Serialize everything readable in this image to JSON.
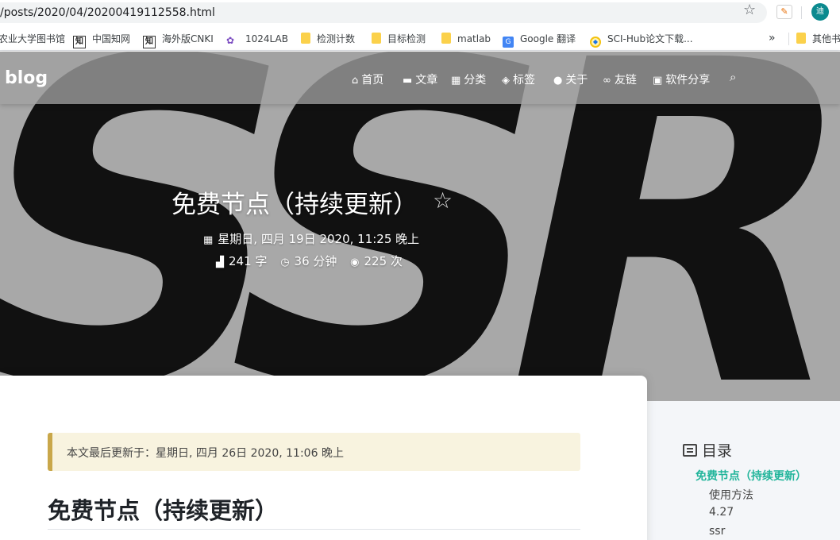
{
  "browser": {
    "url": "/posts/2020/04/20200419112558.html",
    "profile_initial": "迪",
    "bookmarks": [
      {
        "label": "农业大学图书馆",
        "icon": "none"
      },
      {
        "label": "中国知网",
        "icon": "zhi-icon"
      },
      {
        "label": "海外版CNKI",
        "icon": "zhi-icon"
      },
      {
        "label": "1024LAB",
        "icon": "lab-icon"
      },
      {
        "label": "检测计数",
        "icon": "folder-icon"
      },
      {
        "label": "目标检测",
        "icon": "folder-icon"
      },
      {
        "label": "matlab",
        "icon": "folder-icon"
      },
      {
        "label": "Google 翻译",
        "icon": "google-translate-icon"
      },
      {
        "label": "SCI-Hub论文下载...",
        "icon": "scihub-icon"
      },
      {
        "label": "其他书",
        "icon": "folder-icon"
      }
    ],
    "more_label": "»"
  },
  "site": {
    "brand": "blog",
    "nav": [
      {
        "label": "首页",
        "icon": "home-icon"
      },
      {
        "label": "文章",
        "icon": "archive-icon"
      },
      {
        "label": "分类",
        "icon": "category-icon"
      },
      {
        "label": "标签",
        "icon": "tags-icon"
      },
      {
        "label": "关于",
        "icon": "user-icon"
      },
      {
        "label": "友链",
        "icon": "link-icon"
      },
      {
        "label": "软件分享",
        "icon": "software-icon"
      }
    ],
    "hero_art_text": "SSR"
  },
  "post": {
    "title": "免费节点（持续更新）",
    "date": "星期日, 四月 19日 2020, 11:25 晚上",
    "words": "241 字",
    "read_time": "36 分钟",
    "views": "225 次",
    "updated_notice": "本文最后更新于：星期日, 四月 26日 2020, 11:06 晚上",
    "heading": "免费节点（持续更新）"
  },
  "toc": {
    "title": "目录",
    "items": [
      {
        "label": "免费节点（持续更新）",
        "active": true
      },
      {
        "label": "使用方法",
        "active": false
      },
      {
        "label": "4.27",
        "active": false
      },
      {
        "label": "ssr",
        "active": false
      }
    ]
  }
}
